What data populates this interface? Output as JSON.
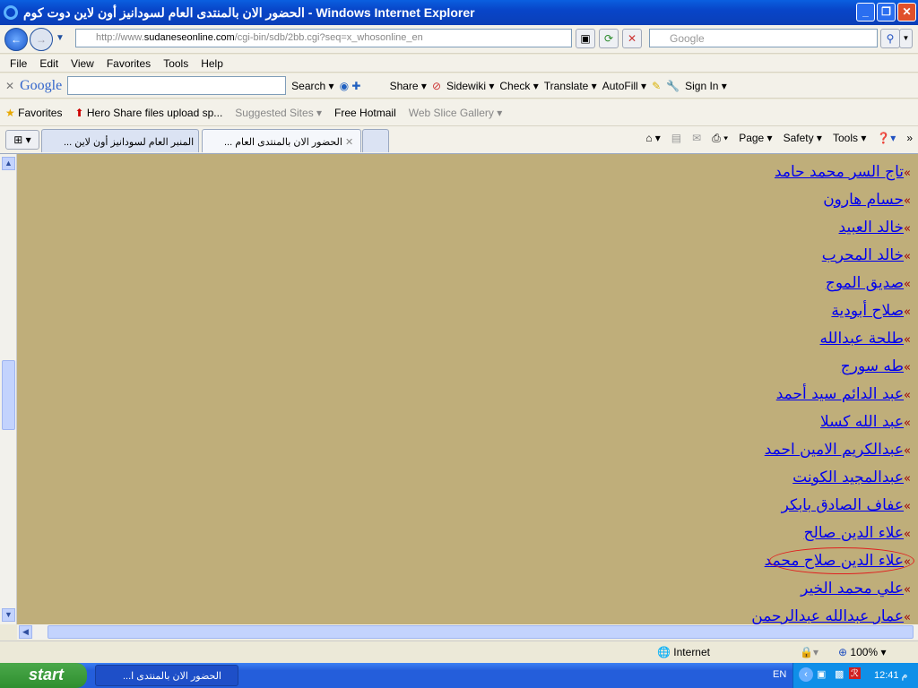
{
  "window": {
    "title": "الحضور الان بالمنتدى العام لسودانيز أون لاين دوت كوم - Windows Internet Explorer",
    "min": "_",
    "max": "❐",
    "close": "✕"
  },
  "address": {
    "url_prefix": "http://www.",
    "url_domain": "sudaneseonline.com",
    "url_path": "/cgi-bin/sdb/2bb.cgi?seq=x_whosonline_en",
    "search_placeholder": "Google"
  },
  "menu": [
    "File",
    "Edit",
    "View",
    "Favorites",
    "Tools",
    "Help"
  ],
  "google_toolbar": {
    "logo": "Google",
    "search": "Search ▾",
    "share": "Share ▾",
    "sidewiki": "Sidewiki ▾",
    "check": "Check ▾",
    "translate": "Translate ▾",
    "autofill": "AutoFill ▾",
    "signin": "Sign In ▾"
  },
  "favorites": {
    "label": "Favorites",
    "items": [
      "Hero Share  files upload  sp...",
      "Suggested Sites ▾",
      "Free Hotmail",
      "Web Slice Gallery ▾"
    ]
  },
  "tabs": [
    {
      "label": "... المنبر العام لسودانيز أون لاين"
    },
    {
      "label": "... الحضور الان بالمنتدى العام",
      "active": true
    }
  ],
  "command_bar": [
    "Page ▾",
    "Safety ▾",
    "Tools ▾"
  ],
  "page": {
    "bullet": "»",
    "members": [
      "تاج السر محمد حامد",
      "حسام هارون",
      "خالد العبيد",
      "خالد المحرب",
      "صديق الموج",
      "صلاح أبودية",
      "طلحة عبدالله",
      "طه سورج",
      "عبد الدائم سيد أحمد",
      "عبد الله كسلا",
      "عبدالكريم الامين احمد",
      "عبدالمجيد الكونت",
      "عفاف الصادق بابكر",
      "علاء الدين صالح",
      "علاء الدين صلاح محمد",
      "علي محمد الخير",
      "عمار عبدالله عبدالرحمن"
    ],
    "highlighted_index": 14,
    "background": "#bfae7a",
    "link_color": "#0000ee"
  },
  "status": {
    "zone": "Internet",
    "zoom": "100%"
  },
  "taskbar": {
    "start": "start",
    "task": "...الحضور الان بالمنتدى ا",
    "lang": "EN",
    "clock": "12:41 م"
  }
}
